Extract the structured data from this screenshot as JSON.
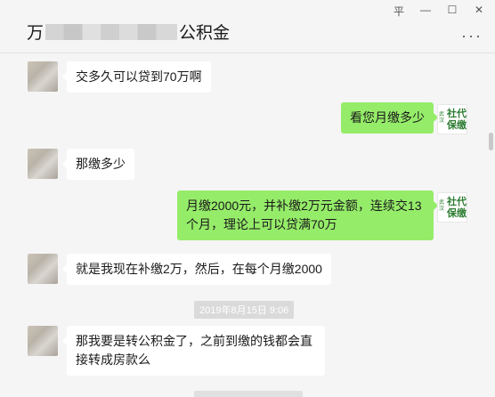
{
  "header": {
    "title_prefix": "万",
    "title_suffix": "公积金",
    "more_icon": "more-dots-icon"
  },
  "window_controls": {
    "pin": "平",
    "minimize": "—",
    "maximize": "☐",
    "close": "✕"
  },
  "avatar_logo": {
    "small_text": "武汉",
    "big_text": "社代保缴",
    "color": "#2e7d32"
  },
  "messages": [
    {
      "side": "in",
      "text": "交多久可以贷到70万啊"
    },
    {
      "side": "out",
      "text": "看您月缴多少"
    },
    {
      "side": "in",
      "text": "那缴多少"
    },
    {
      "side": "out",
      "text": "月缴2000元，并补缴2万元金额，连续交13个月，理论上可以贷满70万"
    },
    {
      "side": "in",
      "text": "就是我现在补缴2万，然后，在每个月缴2000"
    },
    {
      "side": "in",
      "text": "那我要是转公积金了，之前到缴的钱都会直接转成房款么"
    }
  ],
  "timestamp": "2019年8月15日 9:06",
  "colors": {
    "background": "#f5f5f5",
    "outgoing_bubble": "#95ec69",
    "incoming_bubble": "#ffffff"
  }
}
